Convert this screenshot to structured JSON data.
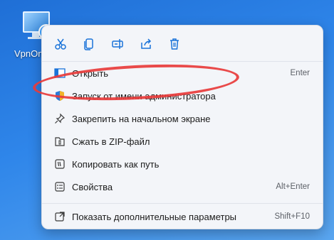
{
  "desktop": {
    "icon_label": "VpnOn"
  },
  "toolbar": [
    {
      "name": "cut-icon"
    },
    {
      "name": "copy-icon"
    },
    {
      "name": "rename-icon"
    },
    {
      "name": "share-icon"
    },
    {
      "name": "delete-icon"
    }
  ],
  "items": [
    {
      "label": "Открыть",
      "shortcut": "Enter",
      "icon": "open-icon"
    },
    {
      "label": "Запуск от имени администратора",
      "shortcut": "",
      "icon": "shield-icon"
    },
    {
      "label": "Закрепить на начальном экране",
      "shortcut": "",
      "icon": "pin-icon"
    },
    {
      "label": "Сжать в ZIP-файл",
      "shortcut": "",
      "icon": "zip-icon"
    },
    {
      "label": "Копировать как путь",
      "shortcut": "",
      "icon": "copy-path-icon"
    },
    {
      "label": "Свойства",
      "shortcut": "Alt+Enter",
      "icon": "properties-icon"
    },
    {
      "label": "Показать дополнительные параметры",
      "shortcut": "Shift+F10",
      "icon": "more-options-icon"
    }
  ],
  "colors": {
    "accent": "#1a73d9",
    "highlight_ring": "#e83b3b"
  }
}
